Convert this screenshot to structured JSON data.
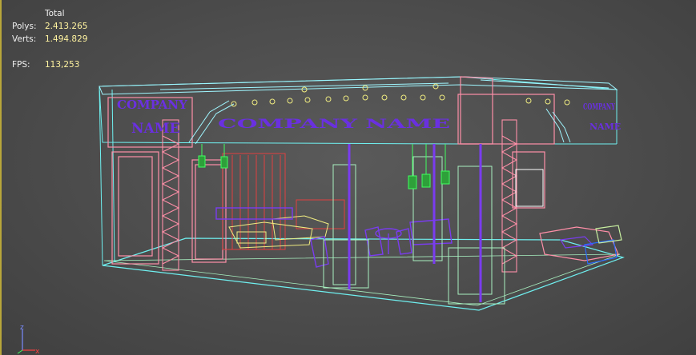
{
  "stats": {
    "header": "Total",
    "polys_label": "Polys:",
    "polys_value": "2.413.265",
    "verts_label": "Verts:",
    "verts_value": "1.494.829",
    "fps_label": "FPS:",
    "fps_value": "113,253"
  },
  "signs": {
    "left_line1": "COMPANY",
    "left_line2": "NAME",
    "center": "COMPANY NAME",
    "right_line1": "COMPANY",
    "right_line2": "NAME"
  },
  "gizmo": {
    "z_axis": "z",
    "x_axis": "x"
  },
  "colors": {
    "background": "#4c4c4c",
    "stat_value": "#fff3a0",
    "wire_cyan": "#6ff0f0",
    "wire_pink": "#ff8fa8",
    "wire_purple": "#7a3cf0",
    "wire_yellow": "#f0ec80",
    "wire_green": "#40ff60",
    "wire_red": "#e04040",
    "gizmo_z": "#7a8cff",
    "gizmo_x": "#ff4040"
  }
}
